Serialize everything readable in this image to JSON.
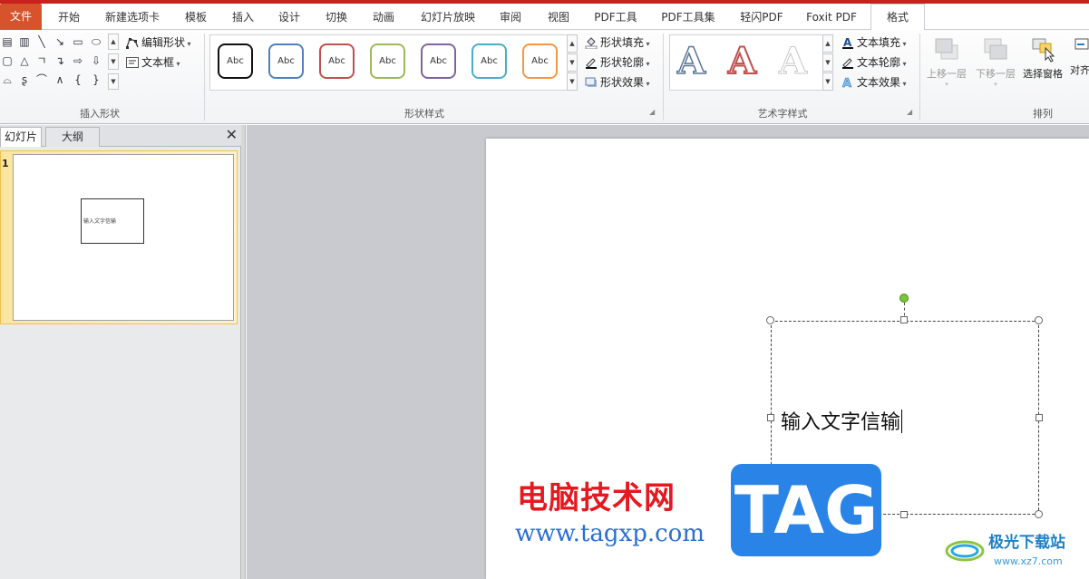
{
  "ribbon_tabs": {
    "file": "文件",
    "home": "开始",
    "new_tab": "新建选项卡",
    "template": "模板",
    "insert": "插入",
    "design": "设计",
    "transitions": "切换",
    "animations": "动画",
    "slideshow": "幻灯片放映",
    "review": "审阅",
    "view": "视图",
    "pdf_tools": "PDF工具",
    "pdf_toolset": "PDF工具集",
    "qingshan_pdf": "轻闪PDF",
    "foxit_pdf": "Foxit PDF",
    "format": "格式"
  },
  "insert_shapes": {
    "edit_shape": "编辑形状",
    "text_box": "文本框",
    "group_label": "插入形状"
  },
  "shape_styles": {
    "samples": [
      {
        "label": "Abc",
        "color": "#111111"
      },
      {
        "label": "Abc",
        "color": "#4f81bd"
      },
      {
        "label": "Abc",
        "color": "#c0504d"
      },
      {
        "label": "Abc",
        "color": "#9bbb59"
      },
      {
        "label": "Abc",
        "color": "#8064a2"
      },
      {
        "label": "Abc",
        "color": "#4bacc6"
      },
      {
        "label": "Abc",
        "color": "#f79646"
      }
    ],
    "fill": "形状填充",
    "outline": "形状轮廓",
    "effects": "形状效果",
    "group_label": "形状样式"
  },
  "wordart": {
    "samples": [
      "A",
      "A",
      "A"
    ],
    "text_fill": "文本填充",
    "text_outline": "文本轮廓",
    "text_effects": "文本效果",
    "group_label": "艺术字样式"
  },
  "arrange": {
    "bring_forward": "上移一层",
    "send_backward": "下移一层",
    "selection_pane": "选择窗格",
    "align": "对齐",
    "group_label": "排列"
  },
  "panel": {
    "tab_slides": "幻灯片",
    "tab_outline": "大纲",
    "close": "✕",
    "slide_number": "1",
    "thumb_text": "输入文字信输"
  },
  "slide": {
    "shape_text": "输入文字信输"
  },
  "watermark": {
    "title": "电脑技术网",
    "url": "www.tagxp.com",
    "tag": "TAG",
    "site_name": "极光下载站",
    "site_url": "www.xz7.com"
  }
}
